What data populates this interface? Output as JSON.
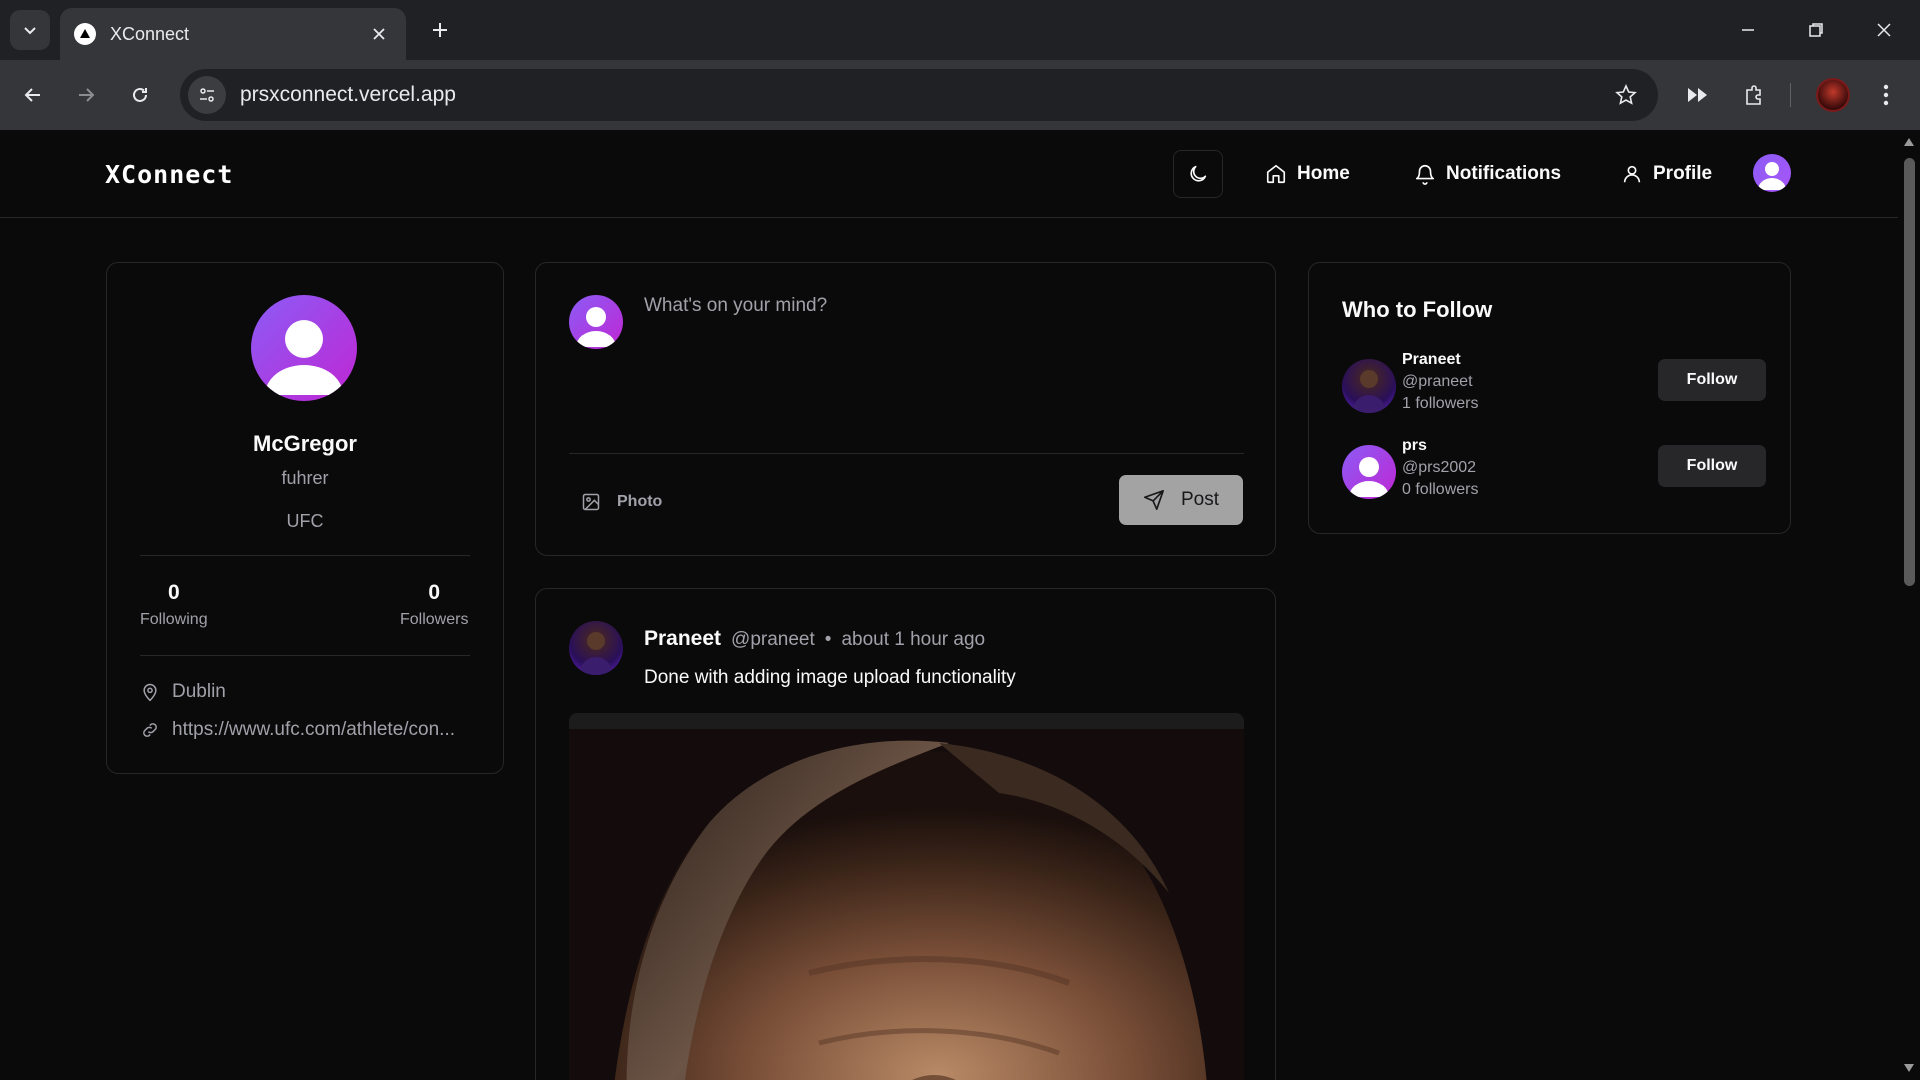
{
  "browser": {
    "tab_title": "XConnect",
    "url": "prsxconnect.vercel.app"
  },
  "header": {
    "brand": "XConnect",
    "nav": {
      "home": "Home",
      "notifications": "Notifications",
      "profile": "Profile"
    }
  },
  "profile": {
    "name": "McGregor",
    "username": "fuhrer",
    "bio": "UFC",
    "following_count": "0",
    "following_label": "Following",
    "followers_count": "0",
    "followers_label": "Followers",
    "location": "Dublin",
    "website": "https://www.ufc.com/athlete/con..."
  },
  "composer": {
    "placeholder": "What's on your mind?",
    "photo_label": "Photo",
    "post_label": "Post"
  },
  "post": {
    "author": "Praneet",
    "handle": "@praneet",
    "separator": "•",
    "time": "about 1 hour ago",
    "content": "Done with adding image upload functionality"
  },
  "who_to_follow": {
    "title": "Who to Follow",
    "users": [
      {
        "name": "Praneet",
        "handle": "@praneet",
        "followers": "1 followers",
        "button": "Follow"
      },
      {
        "name": "prs",
        "handle": "@prs2002",
        "followers": "0 followers",
        "button": "Follow"
      }
    ]
  },
  "colors": {
    "background": "#0a0a0a",
    "border": "#27272a",
    "muted_text": "#a1a1aa",
    "avatar_accent": "#8b5cf6"
  }
}
